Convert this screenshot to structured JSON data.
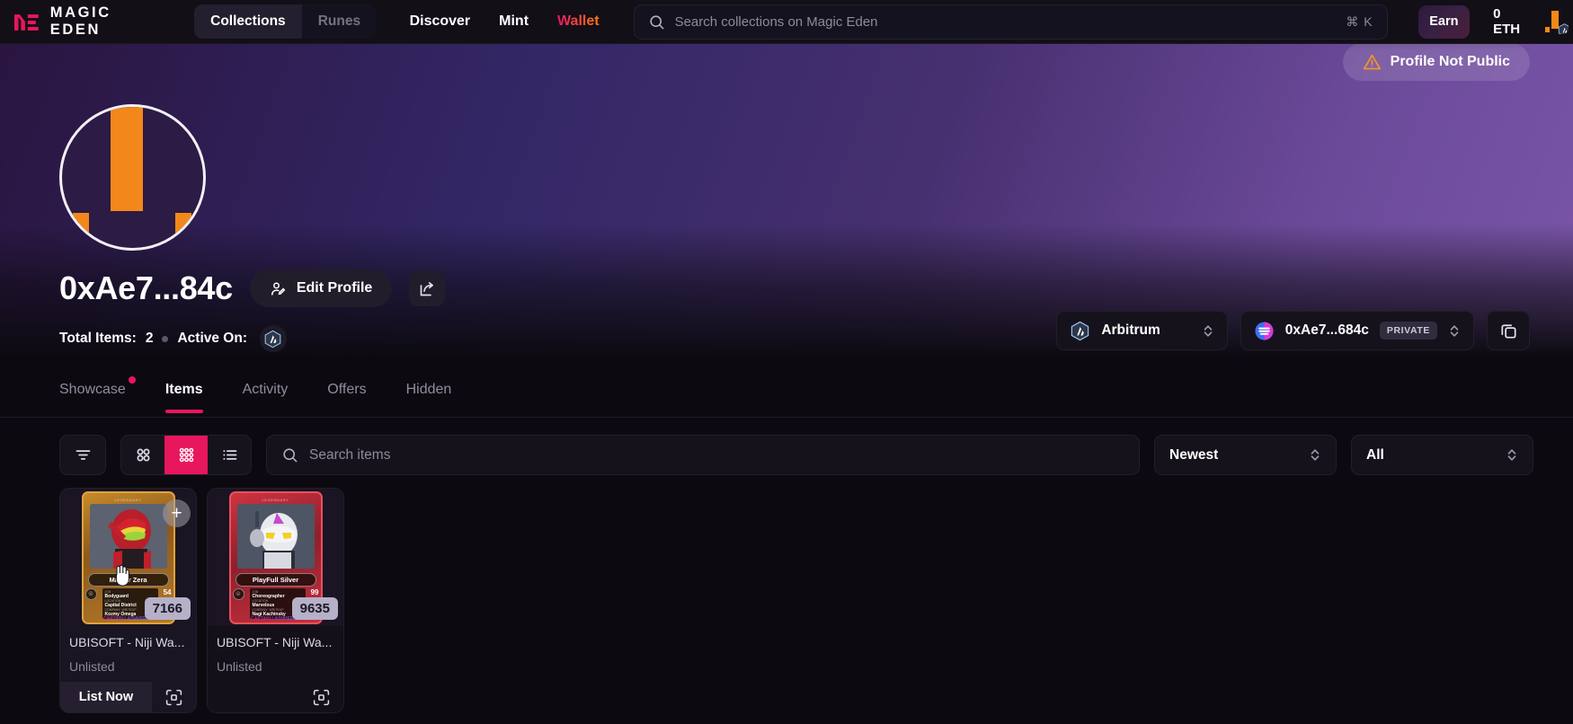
{
  "nav": {
    "brand_name": "MAGIC EDEN",
    "brand_logo_icon": "magic-eden-logo",
    "segments": [
      {
        "label": "Collections",
        "active": true
      },
      {
        "label": "Runes",
        "active": false
      }
    ],
    "links": [
      {
        "label": "Discover",
        "style": "plain"
      },
      {
        "label": "Mint",
        "style": "plain"
      },
      {
        "label": "Wallet",
        "style": "gradient"
      }
    ],
    "search": {
      "placeholder": "Search collections on Magic Eden",
      "icon": "search-icon",
      "shortcut": "⌘ K"
    },
    "earn_label": "Earn",
    "balance": "0 ETH",
    "avatar_icon": "user-avatar-icon",
    "chain_icon": "arbitrum-icon"
  },
  "banner": {
    "not_public": {
      "label": "Profile Not Public",
      "icon": "warning-triangle-icon"
    }
  },
  "profile": {
    "avatar_icon": "profile-avatar-icon",
    "handle": "0xAe7...84c",
    "edit_label": "Edit Profile",
    "edit_icon": "user-edit-icon",
    "share_icon": "share-icon",
    "total_items_label": "Total Items:",
    "total_items_value": "2",
    "active_on_label": "Active On:",
    "active_chain_icon": "arbitrum-icon"
  },
  "selectors": {
    "chain": {
      "label": "Arbitrum",
      "icon": "arbitrum-icon",
      "chevron": "chevron-updown-icon"
    },
    "wallet": {
      "label": "0xAe7...684c",
      "icon": "wallet-token-icon",
      "badge": "PRIVATE",
      "chevron": "chevron-updown-icon"
    },
    "copy_icon": "copy-icon"
  },
  "tabs": [
    {
      "label": "Showcase",
      "active": false,
      "dot": true
    },
    {
      "label": "Items",
      "active": true,
      "dot": false
    },
    {
      "label": "Activity",
      "active": false,
      "dot": false
    },
    {
      "label": "Offers",
      "active": false,
      "dot": false
    },
    {
      "label": "Hidden",
      "active": false,
      "dot": false
    }
  ],
  "toolbar": {
    "filter_icon": "filter-icon",
    "views": [
      {
        "icon": "grid-large-icon",
        "active": false
      },
      {
        "icon": "grid-small-icon",
        "active": true
      },
      {
        "icon": "list-view-icon",
        "active": false
      }
    ],
    "search_placeholder": "Search items",
    "search_icon": "search-icon",
    "sort": {
      "label": "Newest",
      "chevron": "chevron-updown-icon"
    },
    "filter_all": {
      "label": "All",
      "chevron": "chevron-updown-icon"
    }
  },
  "items": [
    {
      "title": "UBISOFT - Niji Wa...",
      "status": "Unlisted",
      "token_id": "7166",
      "list_label": "List Now",
      "scan_icon": "scan-icon",
      "plus_icon": "plus-icon",
      "hovered": true,
      "card_art": {
        "rarity": "LEGENDARY",
        "name": "Master Zera",
        "power": "54",
        "job_key": "JOB",
        "job_value": "Bodyguard",
        "location_key": "LOCATION",
        "location_value": "Capital District",
        "company_key": "COMPANY, WRITEUP",
        "company_value": "Kozmy Omega",
        "footer": "CAPTAIN LASÑHEROS",
        "theme": "gold"
      }
    },
    {
      "title": "UBISOFT - Niji Wa...",
      "status": "Unlisted",
      "token_id": "9635",
      "scan_icon": "scan-icon",
      "hovered": false,
      "card_art": {
        "rarity": "LEGENDARY",
        "name": "PlayFull Silver",
        "power": "99",
        "job_key": "JOB",
        "job_value": "Choreographer",
        "location_key": "LOCATION",
        "location_value": "Marvelous",
        "company_key": "COMPANY, WRITEUP",
        "company_value": "Nagi Kachinsky",
        "footer": "CAPTAIN LASÑHEROS",
        "theme": "red"
      }
    }
  ],
  "colors": {
    "accent": "#e8165d",
    "warning": "#f0932b",
    "background": "#0c0a10",
    "avatar_orange": "#f2881a"
  }
}
